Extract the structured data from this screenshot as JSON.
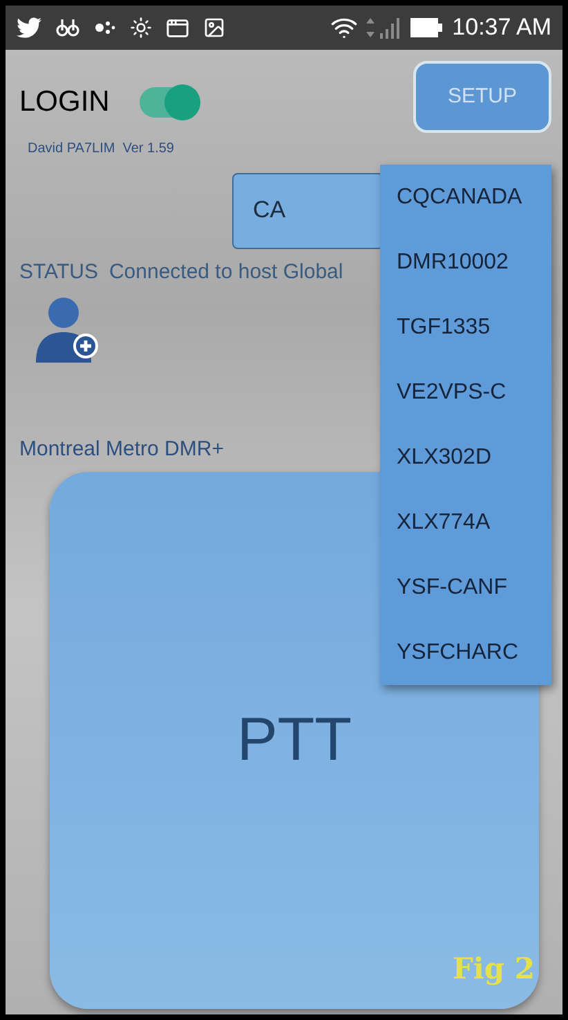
{
  "status_bar": {
    "time": "10:37 AM"
  },
  "login": {
    "label": "LOGIN",
    "on": true
  },
  "setup_button": {
    "label": "SETUP",
    "disabled": true
  },
  "version": "David PA7LIM  Ver 1.59",
  "select": {
    "value": "CA"
  },
  "status": {
    "label": "STATUS",
    "text": "Connected to host Global"
  },
  "room": "Montreal Metro DMR+",
  "ptt_button": {
    "label": "PTT"
  },
  "dropdown": {
    "items": [
      "CQCANADA",
      "DMR10002",
      "TGF1335",
      "VE2VPS-C",
      "XLX302D",
      "XLX774A",
      "YSF-CANF",
      "YSFCHARC"
    ]
  },
  "figure_label": "Fig 2"
}
